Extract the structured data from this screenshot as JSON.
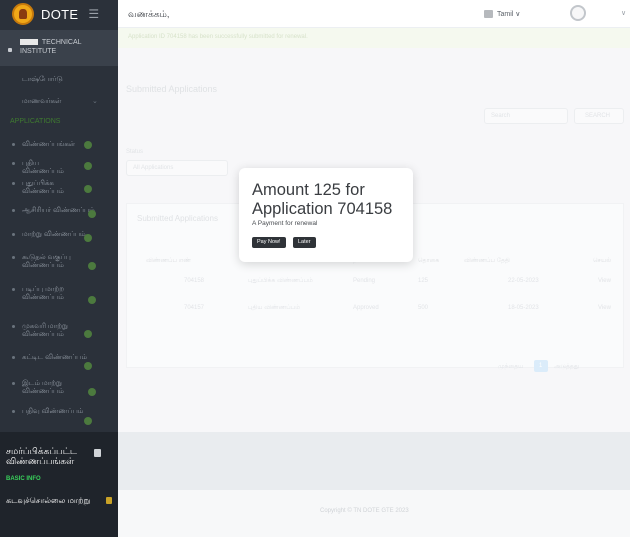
{
  "app": {
    "brand": "DOTE",
    "greeting": "வணக்கம்,",
    "language": "Tamil ∨"
  },
  "sidebar": {
    "user_text": "TECHNICAL INSTITUTE",
    "items": [
      {
        "label": "டாஷ்போர்டு"
      },
      {
        "label": "மாணவர்கள்"
      },
      {
        "label": "APPLICATIONS"
      },
      {
        "label": "விண்ணப்பங்கள்"
      },
      {
        "label": "புதிய விண்ணப்பம்"
      },
      {
        "label": "புதுப்பிக்க விண்ணப்பம்"
      },
      {
        "label": "ஆசிரியர் விண்ணப்பம்"
      },
      {
        "label": "மாற்று விண்ணப்பம்"
      },
      {
        "label": "கூடுதல் வகுப்பு விண்ணப்பம்"
      },
      {
        "label": "படிப்பு மாற்ற விண்ணப்பம்"
      },
      {
        "label": "முகவரி மாற்று விண்ணப்பம்"
      },
      {
        "label": "கட்டிட விண்ணப்பம்"
      },
      {
        "label": "இடம் மாற்று விண்ணப்பம்"
      },
      {
        "label": "பதிவு விண்ணப்பம்"
      }
    ],
    "lower": {
      "approved_label": "சமர்ப்பிக்கப்பட்ட விண்ணப்பங்கள்",
      "basic_info": "BASIC INFO",
      "change_password": "கடவுச்சொல்லை மாற்று"
    }
  },
  "main": {
    "alert": "Application ID 704158 has been successfully submitted for renewal.",
    "page_title": "Submitted Applications",
    "search_placeholder": "Search",
    "search_button": "SEARCH",
    "filter_label": "Status",
    "filter_value": "All Applications",
    "card_title": "Submitted Applications",
    "table_headers": [
      "விண்ணப்ப எண்",
      "விண்ணப்ப வகை",
      "நிலை",
      "தொகை",
      "விண்ணப்ப தேதி",
      "செயல்"
    ],
    "rows": [
      [
        "704158",
        "புதுப்பிக்க விண்ணப்பம்",
        "Pending",
        "125",
        "22-05-2023",
        "View"
      ],
      [
        "704157",
        "புதிய விண்ணப்பம்",
        "Approved",
        "500",
        "18-05-2023",
        "View"
      ]
    ],
    "pagination_prev": "முந்தைய",
    "pagination_current": "1",
    "pagination_next": "அடுத்தது"
  },
  "modal": {
    "title": "Amount 125 for Application 704158",
    "description": "A Payment for renewal",
    "pay_button": "Pay Now!",
    "later_button": "Later"
  },
  "footer": {
    "copyright": "Copyright © TN DOTE GTE 2023"
  }
}
